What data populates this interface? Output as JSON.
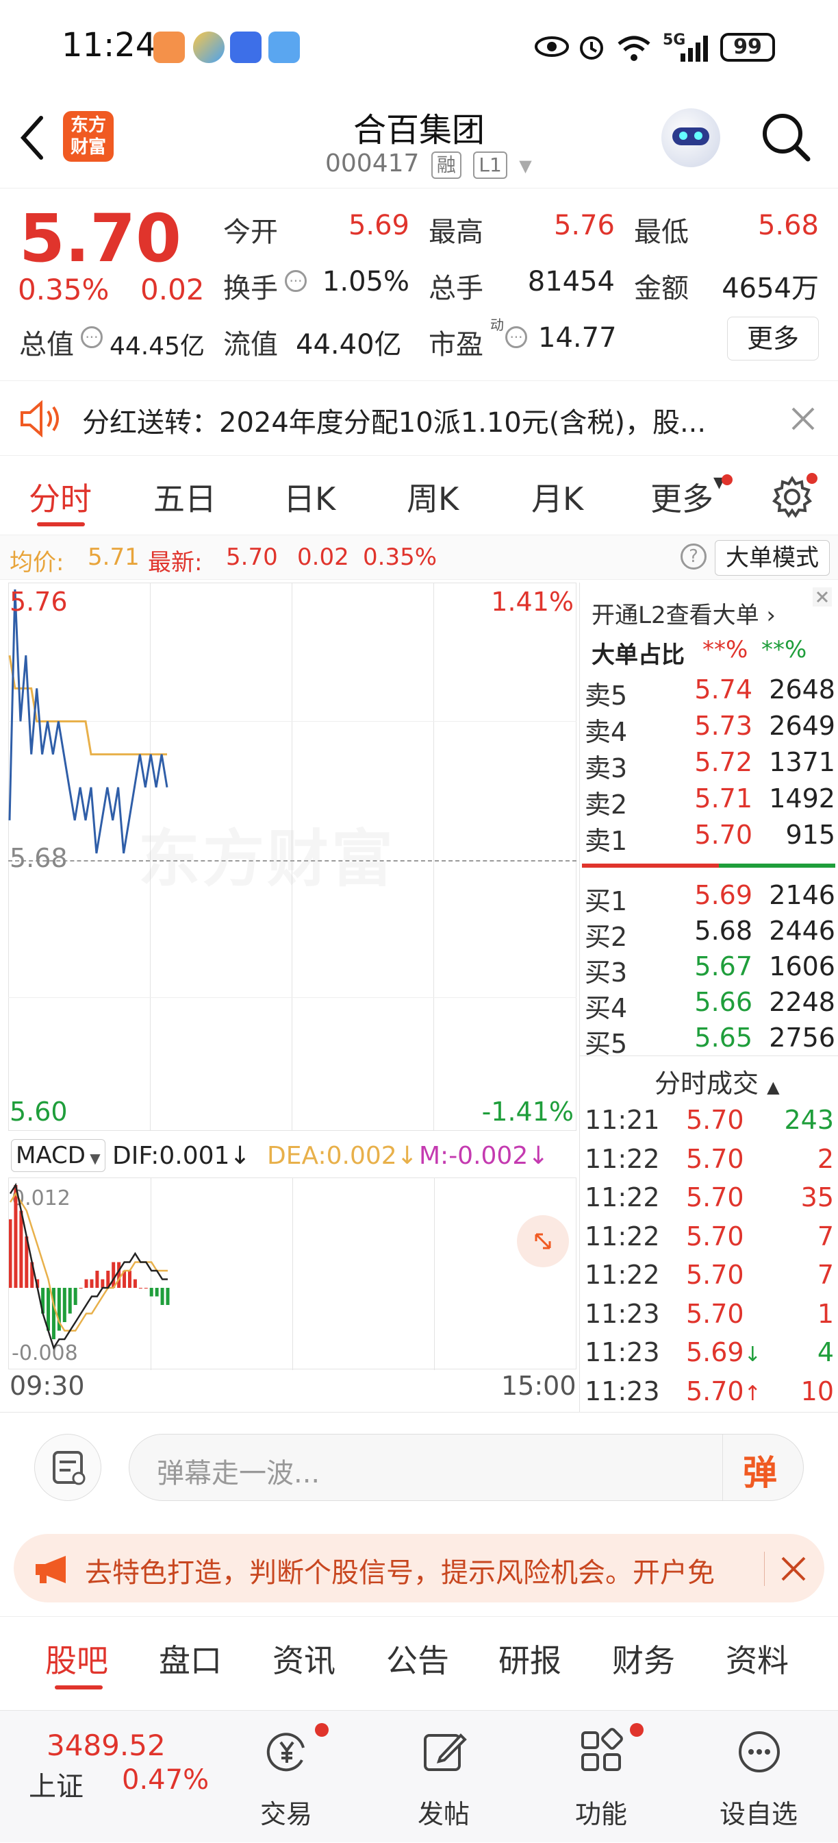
{
  "status_bar": {
    "time": "11:24",
    "signal_label": "5G",
    "battery": "99"
  },
  "header": {
    "logo_text_line1": "东方",
    "logo_text_line2": "财富",
    "title": "合百集团",
    "code": "000417",
    "tag1": "融",
    "tag2": "L1"
  },
  "quote": {
    "price": "5.70",
    "change_pct": "0.35%",
    "change": "0.02",
    "open_label": "今开",
    "open": "5.69",
    "high_label": "最高",
    "high": "5.76",
    "low_label": "最低",
    "low": "5.68",
    "turnover_label": "换手",
    "turnover": "1.05%",
    "volume_label": "总手",
    "volume": "81454",
    "amount_label": "金额",
    "amount": "4654万",
    "mktcap_label": "总值",
    "mktcap": "44.45亿",
    "float_label": "流值",
    "float_cap": "44.40亿",
    "pe_label": "市盈",
    "pe_sup": "动",
    "pe": "14.77",
    "more_button": "更多"
  },
  "notice": {
    "text": "分红送转：2024年度分配10派1.10元(含税)，股..."
  },
  "chart_tabs": [
    "分时",
    "五日",
    "日K",
    "周K",
    "月K",
    "更多"
  ],
  "info_line": {
    "avg_label": "均价:",
    "avg": "5.71",
    "latest_label": "最新:",
    "latest": "5.70",
    "change": "0.02",
    "change_pct": "0.35%",
    "mode_button": "大单模式"
  },
  "chart_labels": {
    "high_price": "5.76",
    "high_pct": "1.41%",
    "mid_price": "5.68",
    "low_price": "5.60",
    "low_pct": "-1.41%",
    "watermark": "东方财富",
    "macd_select": "MACD",
    "dif": "DIF:0.001",
    "dea": "DEA:0.002",
    "m": "M:-0.002",
    "macd_top": "0.012",
    "macd_bottom": "-0.008",
    "time_start": "09:30",
    "time_end": "15:00"
  },
  "chart_data": {
    "type": "line",
    "xlim": [
      "09:30",
      "15:00"
    ],
    "ylim": [
      5.6,
      5.76
    ],
    "series": [
      {
        "name": "最新",
        "values": [
          5.69,
          5.76,
          5.72,
          5.74,
          5.71,
          5.73,
          5.71,
          5.72,
          5.71,
          5.72,
          5.71,
          5.7,
          5.69,
          5.7,
          5.69,
          5.7,
          5.68,
          5.69,
          5.7,
          5.69,
          5.7,
          5.68,
          5.69,
          5.7,
          5.71,
          5.7,
          5.71,
          5.7,
          5.71,
          5.7
        ]
      },
      {
        "name": "均价",
        "values": [
          5.74,
          5.73,
          5.73,
          5.73,
          5.73,
          5.72,
          5.72,
          5.72,
          5.72,
          5.72,
          5.72,
          5.72,
          5.72,
          5.72,
          5.72,
          5.71,
          5.71,
          5.71,
          5.71,
          5.71,
          5.71,
          5.71,
          5.71,
          5.71,
          5.71,
          5.71,
          5.71,
          5.71,
          5.71,
          5.71
        ]
      }
    ],
    "macd": {
      "ylim": [
        -0.008,
        0.012
      ],
      "hist": [
        0.008,
        0.012,
        0.009,
        0.006,
        0.003,
        0.001,
        -0.003,
        -0.005,
        -0.006,
        -0.005,
        -0.004,
        -0.003,
        -0.002,
        0.0,
        0.001,
        0.001,
        0.002,
        0.001,
        0.002,
        0.003,
        0.003,
        0.002,
        0.002,
        0.001,
        0.0,
        0.0,
        -0.001,
        -0.001,
        -0.002,
        -0.002
      ],
      "dif": [
        0.011,
        0.012,
        0.009,
        0.006,
        0.003,
        0.0,
        -0.003,
        -0.005,
        -0.007,
        -0.006,
        -0.006,
        -0.005,
        -0.004,
        -0.003,
        -0.002,
        -0.001,
        -0.001,
        0.0,
        0.0,
        0.001,
        0.002,
        0.003,
        0.003,
        0.004,
        0.003,
        0.003,
        0.002,
        0.002,
        0.001,
        0.001
      ],
      "dea": [
        0.01,
        0.011,
        0.01,
        0.009,
        0.007,
        0.005,
        0.003,
        0.001,
        -0.002,
        -0.004,
        -0.005,
        -0.005,
        -0.005,
        -0.004,
        -0.003,
        -0.003,
        -0.002,
        -0.001,
        0.0,
        0.0,
        0.001,
        0.002,
        0.002,
        0.003,
        0.003,
        0.003,
        0.003,
        0.002,
        0.002,
        0.002
      ]
    }
  },
  "level2": {
    "banner": "开通L2查看大单",
    "ratio_label": "大单占比",
    "ratio_red": "**%",
    "ratio_green": "**%",
    "asks": [
      {
        "label": "卖5",
        "price": "5.74",
        "vol": "2648",
        "color": "red"
      },
      {
        "label": "卖4",
        "price": "5.73",
        "vol": "2649",
        "color": "red"
      },
      {
        "label": "卖3",
        "price": "5.72",
        "vol": "1371",
        "color": "red"
      },
      {
        "label": "卖2",
        "price": "5.71",
        "vol": "1492",
        "color": "red"
      },
      {
        "label": "卖1",
        "price": "5.70",
        "vol": "915",
        "color": "red"
      }
    ],
    "bids": [
      {
        "label": "买1",
        "price": "5.69",
        "vol": "2146",
        "color": "red"
      },
      {
        "label": "买2",
        "price": "5.68",
        "vol": "2446",
        "color": "dark"
      },
      {
        "label": "买3",
        "price": "5.67",
        "vol": "1606",
        "color": "green"
      },
      {
        "label": "买4",
        "price": "5.66",
        "vol": "2248",
        "color": "green"
      },
      {
        "label": "买5",
        "price": "5.65",
        "vol": "2756",
        "color": "green"
      }
    ],
    "trades_title": "分时成交",
    "trades": [
      {
        "time": "11:21",
        "price": "5.70",
        "arrow": "",
        "vol": "243",
        "vcolor": "green"
      },
      {
        "time": "11:22",
        "price": "5.70",
        "arrow": "",
        "vol": "2",
        "vcolor": "red"
      },
      {
        "time": "11:22",
        "price": "5.70",
        "arrow": "",
        "vol": "35",
        "vcolor": "red"
      },
      {
        "time": "11:22",
        "price": "5.70",
        "arrow": "",
        "vol": "7",
        "vcolor": "red"
      },
      {
        "time": "11:22",
        "price": "5.70",
        "arrow": "",
        "vol": "7",
        "vcolor": "red"
      },
      {
        "time": "11:23",
        "price": "5.70",
        "arrow": "",
        "vol": "1",
        "vcolor": "red"
      },
      {
        "time": "11:23",
        "price": "5.69",
        "arrow": "↓",
        "vol": "4",
        "vcolor": "green"
      },
      {
        "time": "11:23",
        "price": "5.70",
        "arrow": "↑",
        "vol": "10",
        "vcolor": "red"
      }
    ]
  },
  "comment": {
    "placeholder": "弹幕走一波...",
    "danmu_button": "弹"
  },
  "promo": {
    "text": "去特色打造，判断个股信号，提示风险机会。开户免"
  },
  "section_tabs": [
    "股吧",
    "盘口",
    "资讯",
    "公告",
    "研报",
    "财务",
    "资料"
  ],
  "bottom_nav": {
    "index_value": "3489.52",
    "index_name": "上证",
    "index_pct": "0.47%",
    "items": [
      "交易",
      "发帖",
      "功能",
      "设自选"
    ]
  },
  "colors": {
    "red": "#e0342c",
    "green": "#1f9e3b",
    "avg_line": "#e8b04a",
    "price_line": "#2f5ea8",
    "accent_orange": "#f05a22"
  }
}
